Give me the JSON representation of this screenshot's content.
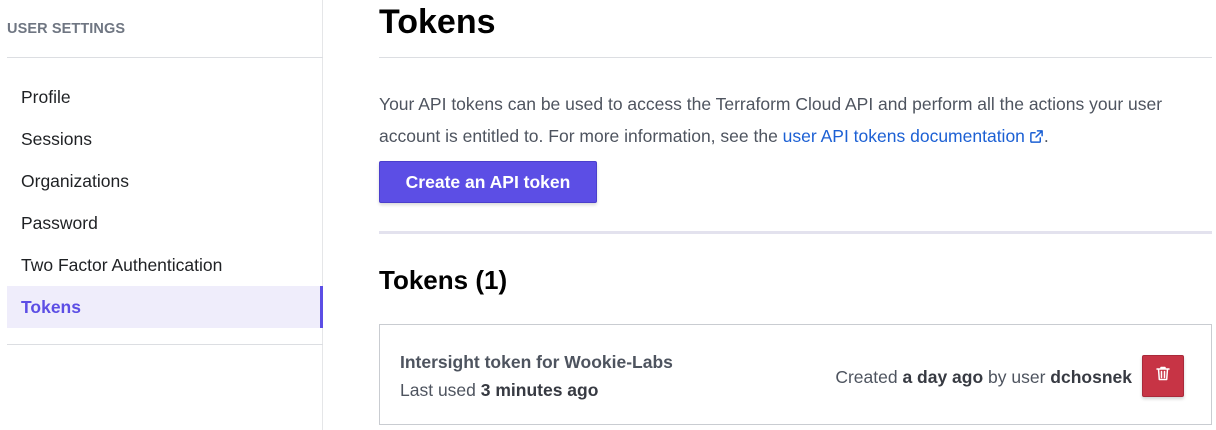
{
  "sidebar": {
    "heading": "USER SETTINGS",
    "items": [
      {
        "label": "Profile"
      },
      {
        "label": "Sessions"
      },
      {
        "label": "Organizations"
      },
      {
        "label": "Password"
      },
      {
        "label": "Two Factor Authentication"
      },
      {
        "label": "Tokens",
        "active": true
      }
    ]
  },
  "main": {
    "title": "Tokens",
    "description_prefix": "Your API tokens can be used to access the Terraform Cloud API and perform all the actions your user account is entitled to. For more information, see the ",
    "doc_link_label": "user API tokens documentation",
    "description_suffix": ".",
    "create_button_label": "Create an API token",
    "section_title": "Tokens (1)",
    "tokens": [
      {
        "name": "Intersight token for Wookie-Labs",
        "last_used_prefix": "Last used ",
        "last_used_value": "3 minutes ago",
        "created_prefix": "Created ",
        "created_value": "a day ago",
        "by_prefix": " by user ",
        "user": "dchosnek",
        "delete_icon": "trash-icon"
      }
    ]
  },
  "colors": {
    "accent": "#5c4ee5",
    "active_bg": "#efedfb",
    "link": "#1c60d4",
    "danger": "#c73445"
  }
}
